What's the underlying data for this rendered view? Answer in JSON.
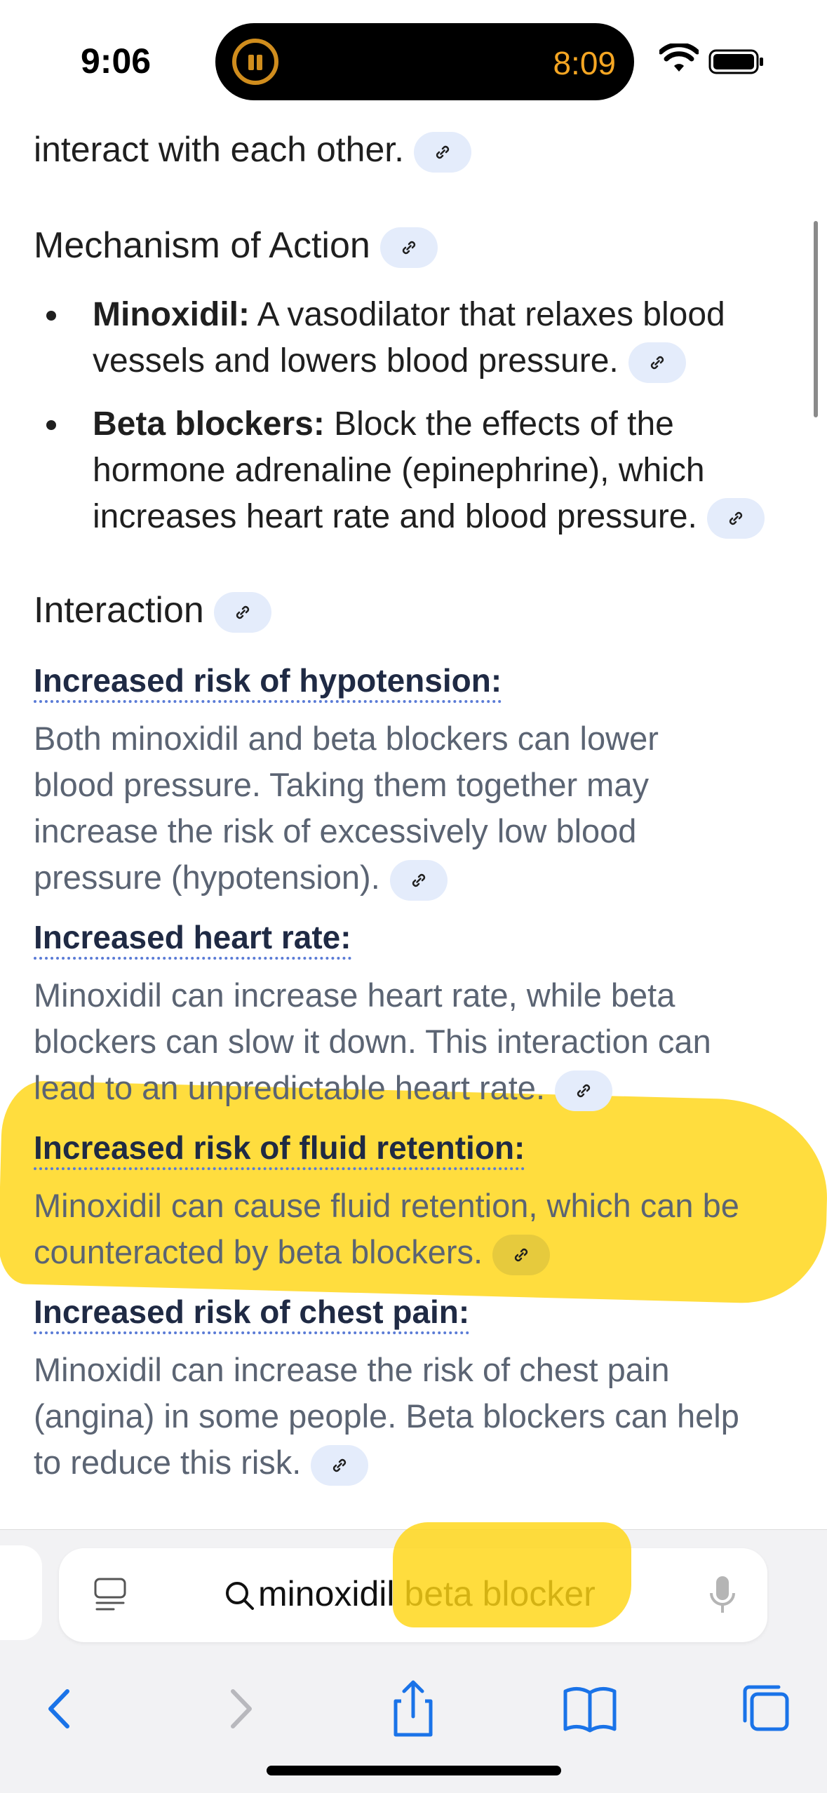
{
  "status_bar": {
    "time": "9:06",
    "island_timer": "8:09"
  },
  "content": {
    "top_fragment": "interact with each other.",
    "mechanism": {
      "heading": "Mechanism of Action",
      "bullets": [
        {
          "term": "Minoxidil:",
          "line1": " A vasodilator that relaxes blood",
          "line2": "vessels and lowers blood pressure."
        },
        {
          "term": "Beta blockers:",
          "line1": " Block the effects of the",
          "line2": "hormone adrenaline (epinephrine), which",
          "line3": "increases heart rate and blood pressure."
        }
      ]
    },
    "interaction": {
      "heading": "Interaction",
      "items": [
        {
          "title": "Increased risk of hypotension:",
          "lines": [
            "Both minoxidil and beta blockers can lower",
            "blood pressure. Taking them together may",
            "increase the risk of excessively low blood",
            "pressure (hypotension)."
          ]
        },
        {
          "title": "Increased heart rate:",
          "lines": [
            "Minoxidil can increase heart rate, while beta",
            "blockers can slow it down. This interaction can",
            "lead to an unpredictable heart rate."
          ]
        },
        {
          "title": "Increased risk of fluid retention:",
          "lines": [
            "Minoxidil can cause fluid retention, which can be",
            "counteracted by beta blockers."
          ]
        },
        {
          "title": "Increased risk of chest pain:",
          "lines": [
            "Minoxidil can increase the risk of chest pain",
            "(angina) in some people. Beta blockers can help",
            "to reduce this risk."
          ]
        }
      ]
    }
  },
  "search": {
    "query": "minoxidil beta blocker"
  },
  "toolbar": {
    "icons": [
      "back-icon",
      "forward-icon",
      "share-icon",
      "bookmarks-icon",
      "tabs-icon"
    ]
  },
  "colors": {
    "accent": "#1a73e8",
    "highlight": "#ffd614",
    "link_pill": "#e4ecfb",
    "timer": "#f5a623"
  }
}
